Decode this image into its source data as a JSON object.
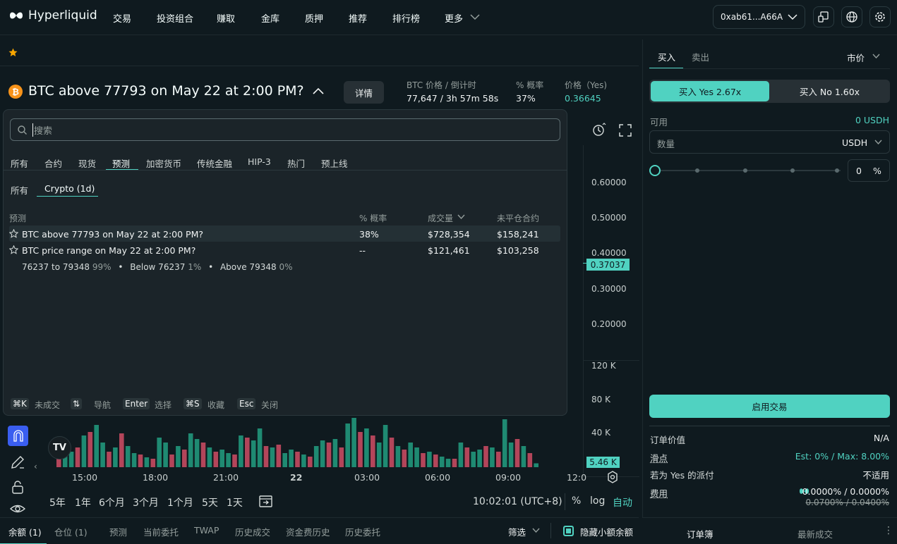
{
  "nav": {
    "logo_text": "Hyperliquid",
    "items": [
      "交易",
      "投资组合",
      "赚取",
      "金库",
      "质押",
      "推荐",
      "排行榜",
      "更多"
    ],
    "wallet": "0xab61...A66A"
  },
  "market": {
    "title": "BTC above 77793 on May 22 at 2:00 PM?",
    "details_btn": "详情",
    "stats": [
      {
        "label": "BTC 价格 / 倒计时",
        "value": "77,647 / 3h 57m 58s"
      },
      {
        "label": "% 概率",
        "value": "37%"
      },
      {
        "label": "价格（Yes)",
        "value": "0.36645"
      }
    ]
  },
  "search": {
    "placeholder": "搜索",
    "tabs": [
      "所有",
      "合约",
      "现货",
      "预测",
      "加密货币",
      "传统金融",
      "HIP-3",
      "热门",
      "预上线"
    ],
    "active_tab": "预测",
    "subtabs": [
      "所有",
      "Crypto (1d)"
    ],
    "active_subtab": "Crypto (1d)",
    "columns": [
      "预测",
      "% 概率",
      "成交量",
      "未平仓合约"
    ],
    "rows": [
      {
        "name": "BTC above 77793 on May 22 at 2:00 PM?",
        "prob": "38%",
        "volume": "$728,354",
        "oi": "$158,241"
      },
      {
        "name": "BTC price range on May 22 at 2:00 PM?",
        "prob": "--",
        "volume": "$121,461",
        "oi": "$103,258"
      }
    ],
    "sub_outcomes": [
      {
        "label": "76237 to 79348",
        "pct": "99%"
      },
      {
        "label": "Below 76237",
        "pct": "1%"
      },
      {
        "label": "Above 79348",
        "pct": "0%"
      }
    ],
    "hints": [
      {
        "key": "⌘K",
        "text": "未成交"
      },
      {
        "key": "⇅",
        "text": "导航"
      },
      {
        "key": "Enter",
        "text": "选择"
      },
      {
        "key": "⌘S",
        "text": "收藏"
      },
      {
        "key": "Esc",
        "text": "关闭"
      }
    ]
  },
  "chart": {
    "y_labels": [
      "0.60000",
      "0.50000",
      "0.40000",
      "0.30000",
      "0.20000"
    ],
    "current_price": "0.37037",
    "vol_labels": [
      "120 K",
      "80 K",
      "40 K"
    ],
    "current_vol": "5.46 K",
    "x_labels": [
      "15:00",
      "18:00",
      "21:00",
      "22",
      "03:00",
      "06:00",
      "09:00",
      "12:0"
    ],
    "ranges": [
      "5年",
      "1年",
      "6个月",
      "3个月",
      "1个月",
      "5天",
      "1天"
    ],
    "clock": "10:02:01 (UTC+8)",
    "pct": "%",
    "log": "log",
    "auto": "自动"
  },
  "chart_data": {
    "type": "bar",
    "title": "",
    "x": [
      "15:00",
      "18:00",
      "21:00",
      "22",
      "03:00",
      "06:00",
      "09:00"
    ],
    "ylim": [
      0,
      140000
    ],
    "series": [
      {
        "values": [
          15000,
          20000,
          22000,
          28000,
          45000,
          50000,
          60000,
          35000,
          22000,
          28000,
          48000,
          30000,
          20000,
          18000,
          14000,
          12000,
          42000,
          35000,
          18000,
          30000,
          25000,
          48000,
          40000,
          35000,
          28000,
          22000,
          25000,
          20000,
          18000,
          45000,
          42000,
          38000,
          55000,
          30000,
          28000,
          32000,
          20000,
          25000,
          22000,
          18000,
          15000,
          30000,
          38000,
          35000,
          40000,
          28000,
          62000,
          70000,
          50000,
          55000,
          45000,
          35000,
          60000,
          42000,
          30000,
          25000,
          35000,
          28000,
          20000,
          22000,
          18000,
          15000,
          12000,
          12000,
          35000,
          28000,
          22000,
          25000,
          30000,
          28000,
          22000,
          68000,
          35000,
          40000,
          30000,
          20000,
          5460
        ]
      }
    ]
  },
  "order": {
    "tabs": [
      "买入",
      "卖出"
    ],
    "order_type": "市价",
    "yes_btn": "买入 Yes 2.67x",
    "no_btn": "买入 No 1.60x",
    "available_label": "可用",
    "available_value": "0 USDH",
    "qty_label": "数量",
    "qty_unit": "USDH",
    "slider_value": "0",
    "slider_unit": "%",
    "enable_btn": "启用交易",
    "details": [
      {
        "label": "订单价值",
        "value": "N/A"
      },
      {
        "label": "滑点",
        "value": "Est: 0% / Max: 8.00%"
      },
      {
        "label": "若为 Yes 的派付",
        "value": "不适用"
      },
      {
        "label": "费用",
        "value": "0.0000% / 0.0000%"
      }
    ],
    "fee_old": "0.0700% / 0.0400%"
  },
  "bottom": {
    "tabs": [
      "余额 (1)",
      "仓位 (1)",
      "预测",
      "当前委托",
      "TWAP",
      "历史成交",
      "资金费历史",
      "历史委托"
    ],
    "filter": "筛选",
    "hide_small": "隐藏小额余额",
    "right_tabs": [
      "订单簿",
      "最新成交"
    ]
  },
  "colors": {
    "accent": "#50d2c1",
    "red": "#ed7088",
    "bg": "#0f1a1f",
    "panel": "#1b2429"
  }
}
